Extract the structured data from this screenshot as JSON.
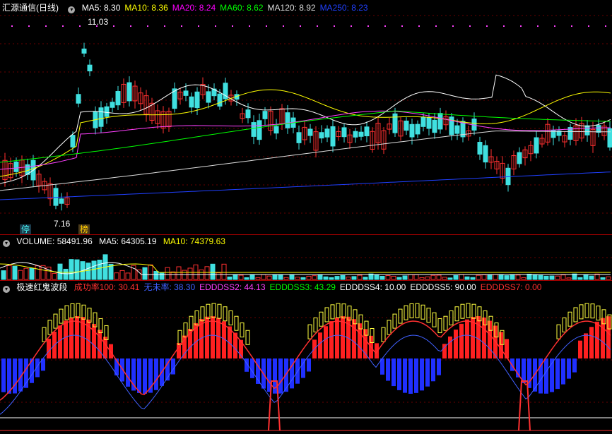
{
  "main_panel": {
    "stock_name": "汇源通信(日线)",
    "ma": [
      {
        "label": "MA5: 8.30",
        "color": "#ffffff"
      },
      {
        "label": "MA10: 8.36",
        "color": "#ffff00"
      },
      {
        "label": "MA20: 8.24",
        "color": "#ff00ff"
      },
      {
        "label": "MA60: 8.62",
        "color": "#00ff00"
      },
      {
        "label": "MA120: 8.92",
        "color": "#dddddd"
      },
      {
        "label": "MA250: 8.23",
        "color": "#2040ff"
      }
    ],
    "high_label": "11.03",
    "low_label": "7.16",
    "tag_stop": "停",
    "tag_board": "榜"
  },
  "volume_panel": {
    "title": "VOLUME: 58491.96",
    "ma5": "MA5: 64305.19",
    "ma10": "MA10: 74379.63"
  },
  "indicator_panel": {
    "name": "极速红鬼波段",
    "items": [
      {
        "label": "成功率100: 30.41",
        "color": "#ff3030"
      },
      {
        "label": "无未率: 38.30",
        "color": "#4060ff"
      },
      {
        "label": "EDDDSS2: 44.13",
        "color": "#ff40ff"
      },
      {
        "label": "EDDDSS3: 43.29",
        "color": "#00ff00"
      },
      {
        "label": "EDDDSS4: 10.00",
        "color": "#ffffff"
      },
      {
        "label": "EDDDSS5: 90.00",
        "color": "#ffffff"
      },
      {
        "label": "EDDDSS7: 0.00",
        "color": "#ff3030"
      }
    ]
  },
  "colors": {
    "up": "#ff3030",
    "down": "#40e0e0",
    "separator": "#a00000"
  }
}
